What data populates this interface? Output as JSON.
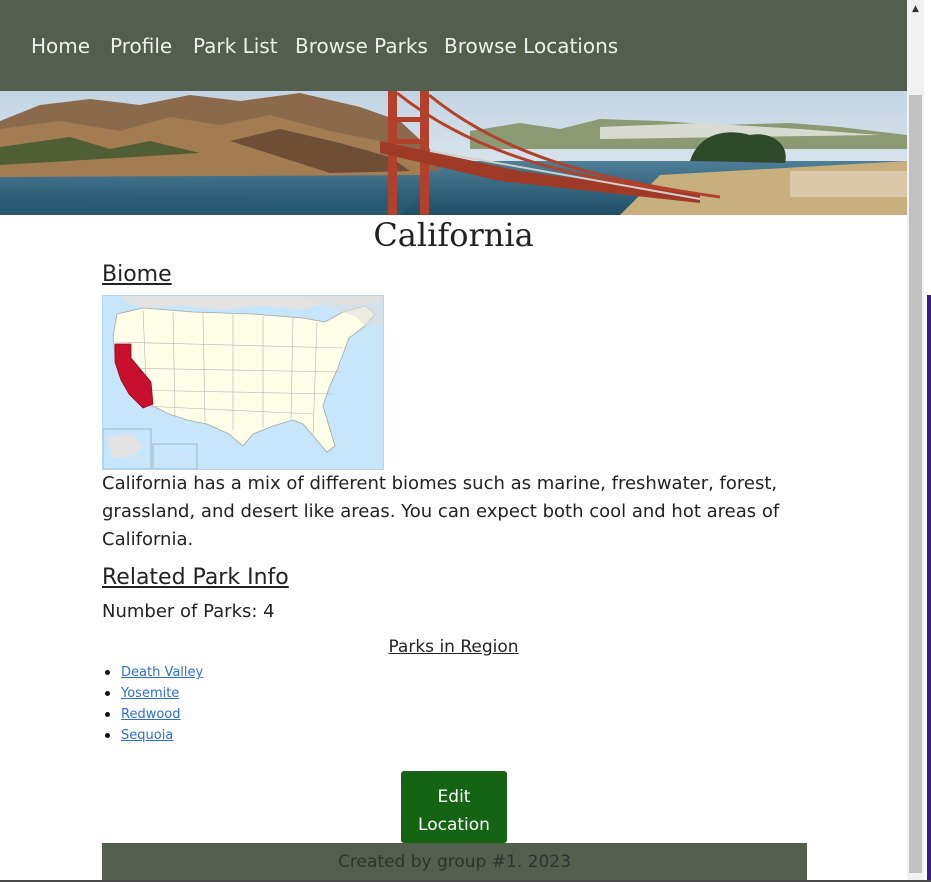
{
  "nav": {
    "items": [
      "Home",
      "Profile",
      "Park List",
      "Browse Parks",
      "Browse Locations"
    ]
  },
  "location": {
    "name": "California",
    "biome_heading": "Biome",
    "description": "California has a mix of different biomes such as marine, freshwater, forest, grassland, and desert like areas. You can expect both cool and hot areas of California."
  },
  "park_info": {
    "heading": "Related Park Info",
    "count_text": "Number of Parks: 4",
    "list_heading": "Parks in Region",
    "parks": [
      "Death Valley",
      "Yosemite",
      "Redwood",
      "Sequoia"
    ]
  },
  "actions": {
    "edit_line1": "Edit",
    "edit_line2": "Location"
  },
  "footer": {
    "text": "Created by group #1. 2023"
  },
  "colors": {
    "nav_bg": "#535e4f",
    "button_bg": "#146414",
    "link": "#2e6dd2",
    "state_highlight": "#c8102e"
  },
  "icons": {
    "scroll_up": "▲"
  }
}
